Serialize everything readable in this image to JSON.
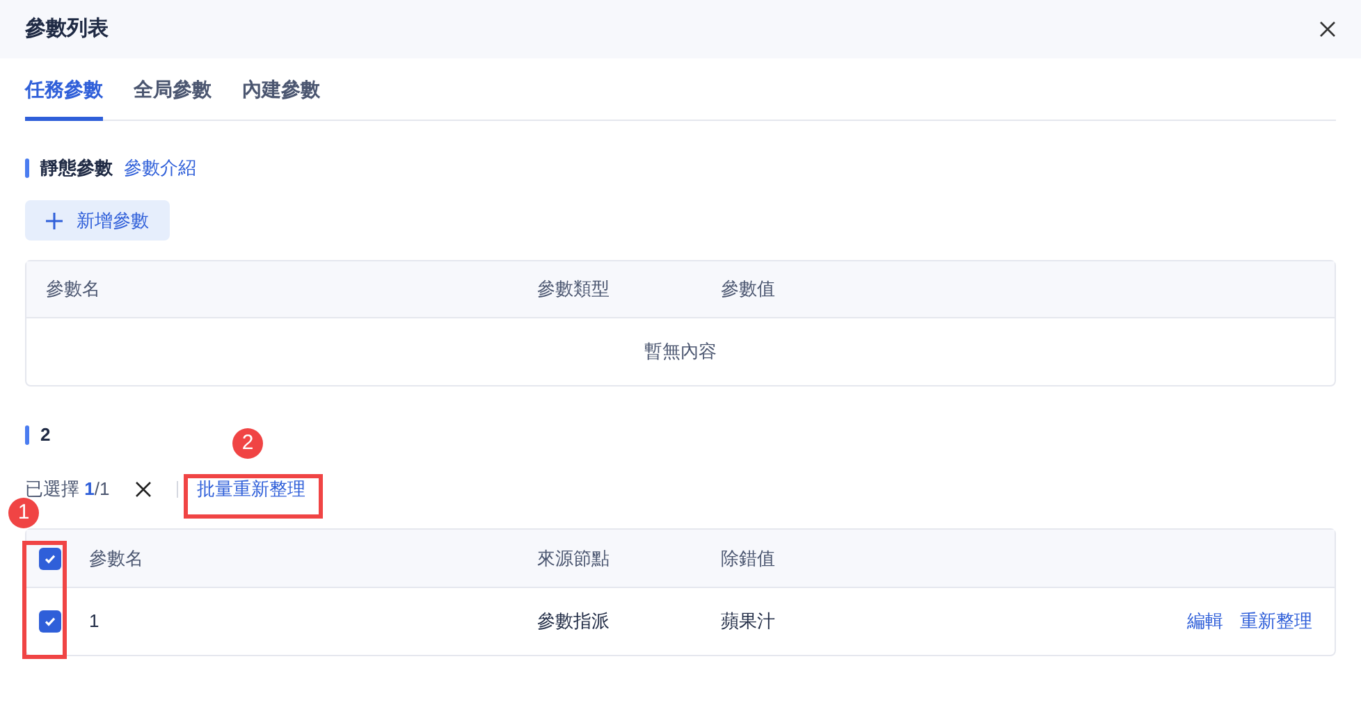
{
  "window": {
    "title": "參數列表"
  },
  "tabs": [
    {
      "label": "任務參數",
      "selected": true
    },
    {
      "label": "全局參數",
      "selected": false
    },
    {
      "label": "內建參數",
      "selected": false
    }
  ],
  "static_section": {
    "title": "靜態參數",
    "link": "參數介紹",
    "add_button": "新增參數",
    "table": {
      "columns": [
        "參數名",
        "參數類型",
        "參數值"
      ],
      "empty_text": "暫無內容"
    }
  },
  "dynamic_section": {
    "title": "2",
    "selection": {
      "label": "已選擇",
      "count": "1",
      "total": "/1"
    },
    "batch_button": "批量重新整理",
    "table": {
      "columns": [
        "參數名",
        "來源節點",
        "除錯值"
      ],
      "header_checked": true,
      "rows": [
        {
          "checked": true,
          "cells": [
            "1",
            "參數指派",
            "蘋果汁"
          ],
          "actions": [
            "編輯",
            "重新整理"
          ]
        }
      ]
    }
  },
  "annotations": [
    {
      "number": "1"
    },
    {
      "number": "2"
    }
  ]
}
